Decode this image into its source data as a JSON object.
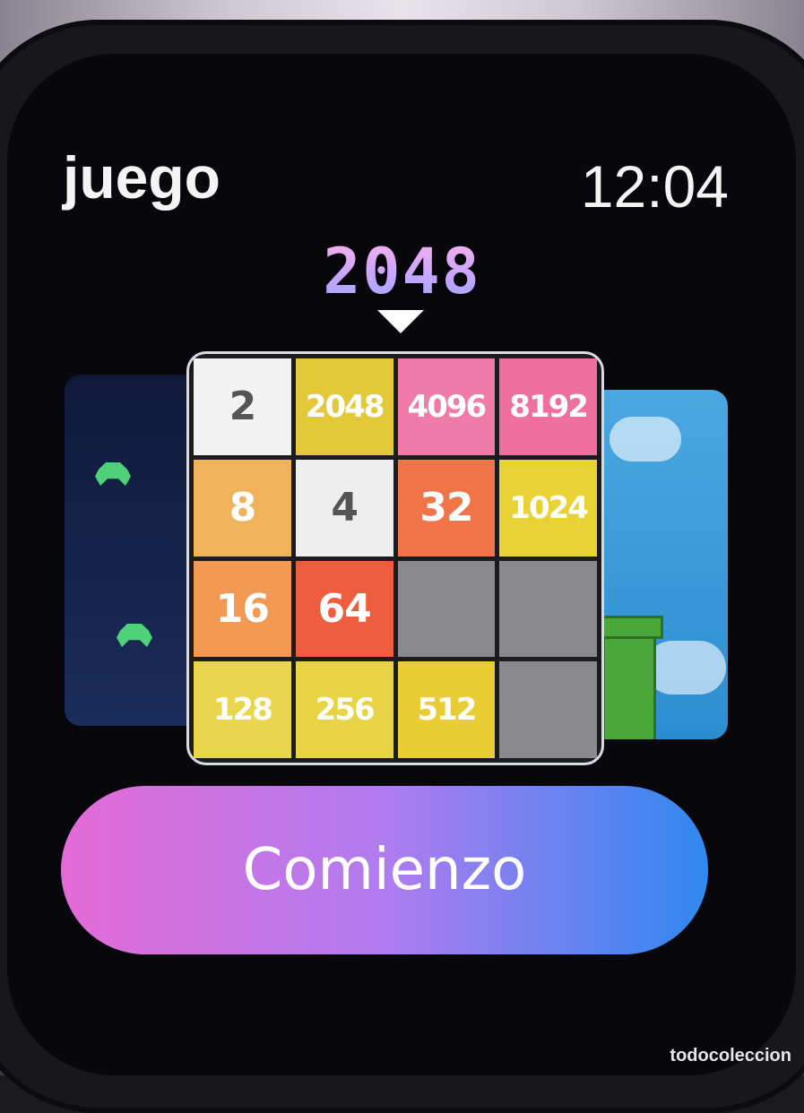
{
  "header": {
    "app_title": "juego",
    "time": "12:04"
  },
  "carousel": {
    "selected_game": "2048",
    "selection_indicator": "caret-down-icon"
  },
  "board": {
    "tiles": [
      {
        "value": "2",
        "color": "#f2f2f2",
        "class": "t2"
      },
      {
        "value": "2048",
        "color": "#e3c93a",
        "class": "sm"
      },
      {
        "value": "4096",
        "color": "#f07aa8",
        "class": "sm"
      },
      {
        "value": "8192",
        "color": "#ef6f9f",
        "class": "sm"
      },
      {
        "value": "8",
        "color": "#f0b25a",
        "class": ""
      },
      {
        "value": "4",
        "color": "#eeeeee",
        "class": "t4"
      },
      {
        "value": "32",
        "color": "#f0764a",
        "class": ""
      },
      {
        "value": "1024",
        "color": "#e9d235",
        "class": "sm"
      },
      {
        "value": "16",
        "color": "#f29a54",
        "class": ""
      },
      {
        "value": "64",
        "color": "#ee5e3e",
        "class": ""
      },
      {
        "value": "",
        "color": "#8a8a8e",
        "class": ""
      },
      {
        "value": "",
        "color": "#8a8a8e",
        "class": ""
      },
      {
        "value": "128",
        "color": "#ead54e",
        "class": "sm"
      },
      {
        "value": "256",
        "color": "#e8d344",
        "class": "sm"
      },
      {
        "value": "512",
        "color": "#eacd34",
        "class": "sm"
      },
      {
        "value": "",
        "color": "#8a8a8e",
        "class": ""
      }
    ]
  },
  "actions": {
    "start_label": "Comienzo"
  },
  "watermark": "todocoleccion"
}
